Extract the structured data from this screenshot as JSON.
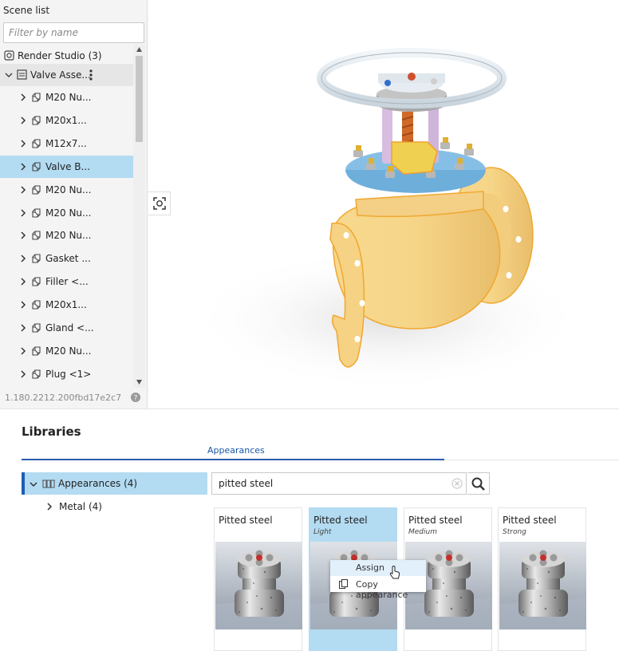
{
  "scene_list": {
    "title": "Scene list",
    "filter_placeholder": "Filter by name",
    "items": [
      {
        "label": "Render Studio (3)",
        "icon": "render-studio-icon"
      },
      {
        "label": "Valve Asse...",
        "icon": "assembly-icon",
        "expanded": true
      },
      {
        "label": "M20 Nu...",
        "icon": "part-icon"
      },
      {
        "label": "M20x1...",
        "icon": "part-icon"
      },
      {
        "label": "M12x7...",
        "icon": "part-icon"
      },
      {
        "label": "Valve B...",
        "icon": "part-icon",
        "selected": true
      },
      {
        "label": "M20 Nu...",
        "icon": "part-icon"
      },
      {
        "label": "M20 Nu...",
        "icon": "part-icon"
      },
      {
        "label": "M20 Nu...",
        "icon": "part-icon"
      },
      {
        "label": "Gasket ...",
        "icon": "part-icon"
      },
      {
        "label": "Filler <...",
        "icon": "part-icon"
      },
      {
        "label": "M20x1...",
        "icon": "part-icon"
      },
      {
        "label": "Gland <...",
        "icon": "part-icon"
      },
      {
        "label": "M20 Nu...",
        "icon": "part-icon"
      },
      {
        "label": "Plug <1>",
        "icon": "part-icon"
      }
    ],
    "version": "1.180.2212.200fbd17e2c7"
  },
  "libraries": {
    "title": "Libraries",
    "tab": "Appearances",
    "tree_root": "Appearances (4)",
    "tree_child": "Metal (4)",
    "search_value": "pitted steel",
    "cards": [
      {
        "title": "Pitted steel",
        "subtitle": ""
      },
      {
        "title": "Pitted steel",
        "subtitle": "Light"
      },
      {
        "title": "Pitted steel",
        "subtitle": "Medium"
      },
      {
        "title": "Pitted steel",
        "subtitle": "Strong"
      }
    ],
    "context_menu": {
      "assign": "Assign",
      "copy": "Copy appearance"
    }
  },
  "colors": {
    "selection": "#b3dbf2",
    "accent": "#1d5fb3",
    "valve_body": "#f5d08a",
    "flange_blue": "#8fc4e8",
    "handwheel": "#dde6ee"
  }
}
